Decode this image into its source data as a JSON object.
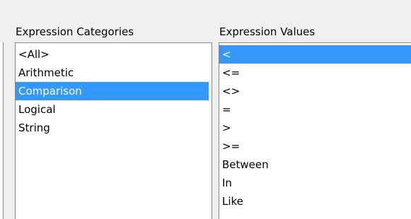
{
  "categories": {
    "label": "Expression Categories",
    "items": [
      "<All>",
      "Arithmetic",
      "Comparison",
      "Logical",
      "String"
    ],
    "selected_index": 2,
    "selection_color": "#3399ff"
  },
  "values": {
    "label": "Expression Values",
    "items": [
      "<",
      "<=",
      "<>",
      "=",
      ">",
      ">=",
      "Between",
      "In",
      "Like"
    ],
    "selected_index": 0,
    "selection_color": "#3399ff"
  }
}
